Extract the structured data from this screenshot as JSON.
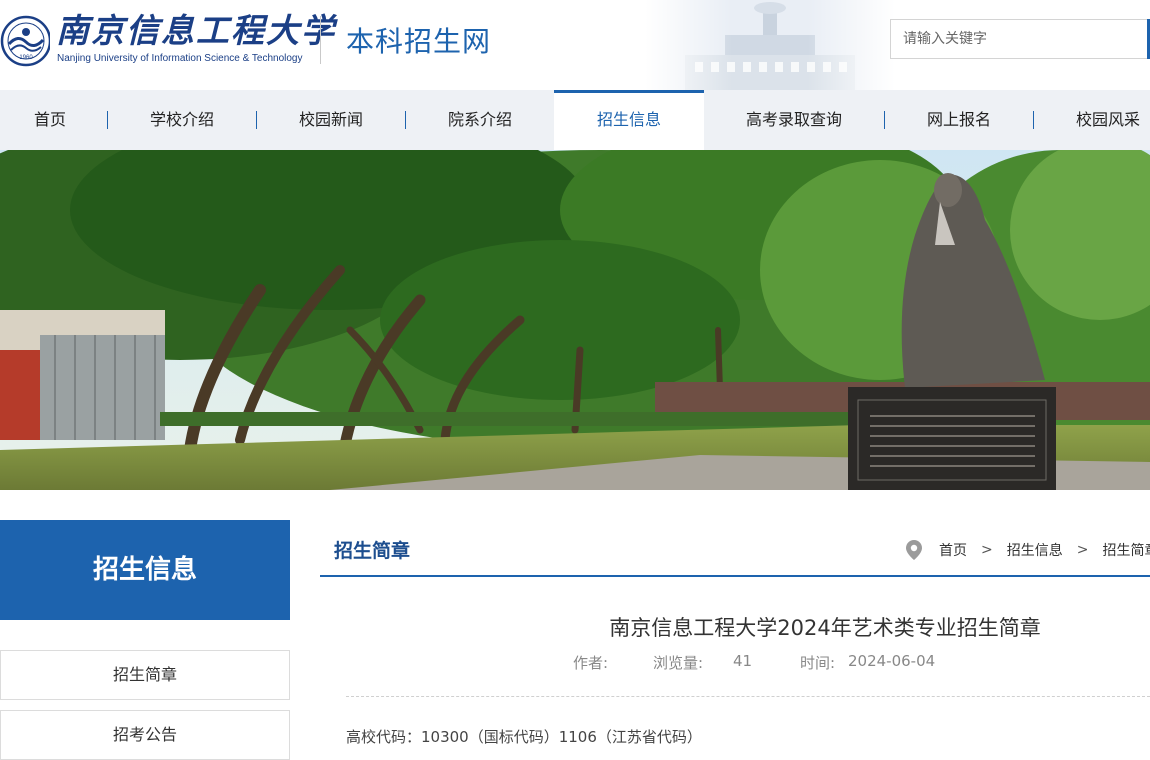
{
  "header": {
    "university_name_cn": "南京信息工程大学",
    "university_name_en": "Nanjing University of Information Science & Technology",
    "emblem_year": "1960",
    "site_name": "本科招生网",
    "search_placeholder": "请输入关键字"
  },
  "nav": {
    "items": [
      {
        "label": "首页"
      },
      {
        "label": "学校介绍"
      },
      {
        "label": "校园新闻"
      },
      {
        "label": "院系介绍"
      },
      {
        "label": "招生信息",
        "active": true
      },
      {
        "label": "高考录取查询"
      },
      {
        "label": "网上报名"
      },
      {
        "label": "校园风采"
      }
    ]
  },
  "sidebar": {
    "title": "招生信息",
    "items": [
      {
        "label": "招生简章"
      },
      {
        "label": "招考公告"
      }
    ]
  },
  "main": {
    "section_title": "招生简章",
    "breadcrumb": [
      "首页",
      "招生信息",
      "招生简章"
    ],
    "article": {
      "title": "南京信息工程大学2024年艺术类专业招生简章",
      "author_label": "作者:",
      "views_label": "浏览量:",
      "views": "41",
      "time_label": "时间:",
      "time": "2024-06-04",
      "first_line": "高校代码：10300（国标代码）1106（江苏省代码）"
    }
  },
  "colors": {
    "brand_blue": "#1d63ae",
    "logo_navy": "#1b3f86",
    "nav_bg": "#eef1f5"
  }
}
